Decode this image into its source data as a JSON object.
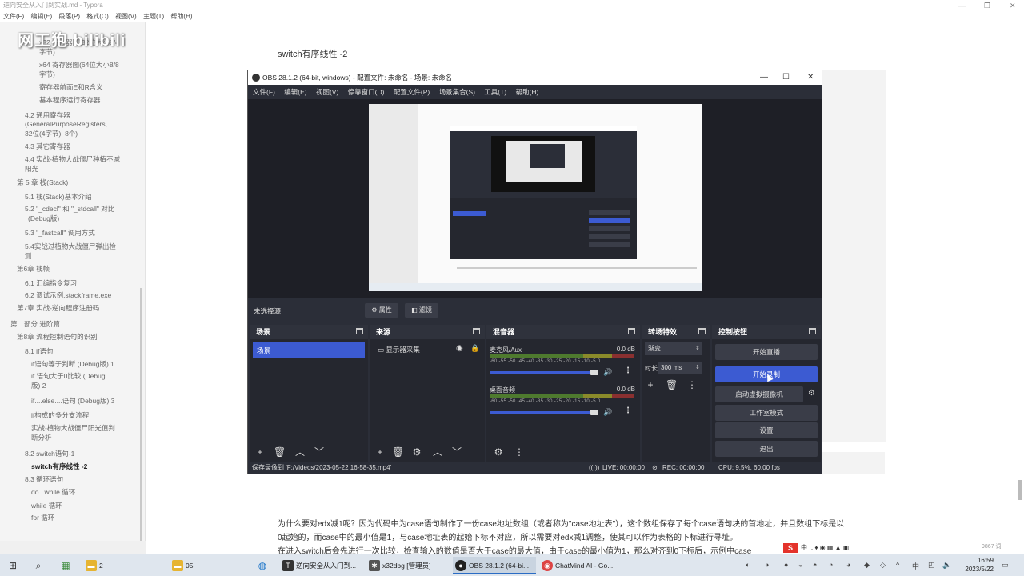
{
  "typora": {
    "title": "逆向安全从入门到实战.md - Typora",
    "menu": [
      "文件(F)",
      "编辑(E)",
      "段落(P)",
      "格式(O)",
      "视图(V)",
      "主题(T)",
      "帮助(H)"
    ],
    "watermark": "网工狍 bilibili",
    "toc": [
      {
        "text": "x32 寄存器图(32位大小8/4",
        "active": false
      },
      {
        "text": "字节)",
        "active": false
      },
      {
        "text": "x64 寄存器图(64位大小8/8",
        "active": false
      },
      {
        "text": "字节)",
        "active": false
      },
      {
        "text": "寄存器前面E和R含义",
        "active": false
      },
      {
        "text": "基本程序运行寄存器",
        "active": false
      },
      {
        "text": "4.2 通用寄存器",
        "active": false
      },
      {
        "text": "(GeneralPurposeRegisters,",
        "active": false
      },
      {
        "text": "32位(4字节), 8个)",
        "active": false
      },
      {
        "text": "4.3 其它寄存器",
        "active": false
      },
      {
        "text": "4.4 实战-植物大战僵尸种植不减",
        "active": false
      },
      {
        "text": "阳光",
        "active": false
      },
      {
        "text": "第 5 章 栈(Stack)",
        "active": false
      },
      {
        "text": "5.1 栈(Stack)基本介绍",
        "active": false
      },
      {
        "text": "5.2 \"_cdecl\" 和 \"_stdcall\" 对比",
        "active": false
      },
      {
        "text": "(Debug版)",
        "active": false
      },
      {
        "text": "5.3 \"_fastcall\" 调用方式",
        "active": false
      },
      {
        "text": "5.4实战过植物大战僵尸弹出检",
        "active": false
      },
      {
        "text": "测",
        "active": false
      },
      {
        "text": "第6章 栈帧",
        "active": false
      },
      {
        "text": "6.1 汇编指令复习",
        "active": false
      },
      {
        "text": "6.2 调试示例.stackframe.exe",
        "active": false
      },
      {
        "text": "第7章 实战-逆向程序注册码",
        "active": false
      },
      {
        "text": "第二部分 进阶篇",
        "active": false
      },
      {
        "text": "第8章 流程控制语句的识别",
        "active": false
      },
      {
        "text": "8.1 if语句",
        "active": false
      },
      {
        "text": "if语句等于判断 (Debug版) 1",
        "active": false
      },
      {
        "text": "if 语句大于0比较 (Debug",
        "active": false
      },
      {
        "text": "版) 2",
        "active": false
      },
      {
        "text": "if....else....语句 (Debug版) 3",
        "active": false
      },
      {
        "text": "if构成的多分支流程",
        "active": false
      },
      {
        "text": "实战-植物大战僵尸阳光值判",
        "active": false
      },
      {
        "text": "断分析",
        "active": false
      },
      {
        "text": "8.2 switch语句-1",
        "active": false
      },
      {
        "text": "switch有序线性 -2",
        "active": true
      },
      {
        "text": "8.3 循环语句",
        "active": false
      },
      {
        "text": "do...while 循环",
        "active": false
      },
      {
        "text": "while 循环",
        "active": false
      },
      {
        "text": "for 循环",
        "active": false
      }
    ],
    "sidebar_foot": [
      "<",
      "</>"
    ],
    "heading": "switch有序线性 -2",
    "para1": "为什么要对edx减1呢？因为代码中为case语句制作了一份case地址数组（或者称为\"case地址表\"），这个数组保存了每个case语句块的首地址，并且数组下标是以",
    "para2": "0起始的，而case中的最小值是1，与case地址表的起始下标不对应，所以需要对edx减1调整，使其可以作为表格的下标进行寻址。",
    "para3": "在进入switch后会先进行一次比较，检查输入的数值是否大于case的最大值，由于case的最小值为1，那么对齐到0下标后，示例中case",
    "word_count": "9867 词"
  },
  "obs": {
    "title": "OBS 28.1.2 (64-bit, windows) - 配置文件: 未命名 - 场景: 未命名",
    "menu": [
      "文件(F)",
      "编辑(E)",
      "视图(V)",
      "停靠窗口(D)",
      "配置文件(P)",
      "场景集合(S)",
      "工具(T)",
      "帮助(H)"
    ],
    "no_source": "未选择源",
    "properties_btn": "属性",
    "filters_btn": "滤镜",
    "docks": {
      "scenes": {
        "title": "场景",
        "items": [
          "场景"
        ]
      },
      "sources": {
        "title": "来源",
        "items": [
          "显示器采集"
        ]
      },
      "mixer": {
        "title": "混音器",
        "channels": [
          {
            "name": "麦克风/Aux",
            "db": "0.0 dB"
          },
          {
            "name": "桌面音频",
            "db": "0.0 dB"
          }
        ],
        "scale": "-60 -55 -50 -45 -40 -35 -30 -25 -20 -15 -10 -5 0"
      },
      "transitions": {
        "title": "转场特效",
        "selected": "渐变",
        "duration_label": "时长",
        "duration": "300 ms"
      },
      "controls": {
        "title": "控制按钮",
        "buttons": [
          "开始直播",
          "开始录制",
          "启动虚拟摄像机",
          "工作室模式",
          "设置",
          "退出"
        ]
      }
    },
    "statusbar": {
      "saved": "保存录像到 'F:/Videos/2023-05-22 16-58-35.mp4'",
      "live": "LIVE: 00:00:00",
      "rec": "REC: 00:00:00",
      "cpu": "CPU: 9.5%, 60.00 fps"
    }
  },
  "ime": {
    "logo": "S",
    "text": "中 ·,  ♦ ◉ ▦ ▲ ▣"
  },
  "taskbar": {
    "tasks": [
      {
        "label": "2"
      },
      {
        "label": "05"
      },
      {
        "label": "逆向安全从入门到..."
      },
      {
        "label": "x32dbg [管理员]"
      },
      {
        "label": "OBS 28.1.2 (64-bi..."
      },
      {
        "label": "ChatMind AI - Go..."
      }
    ],
    "time": "16:59",
    "date": "2023/5/22"
  }
}
